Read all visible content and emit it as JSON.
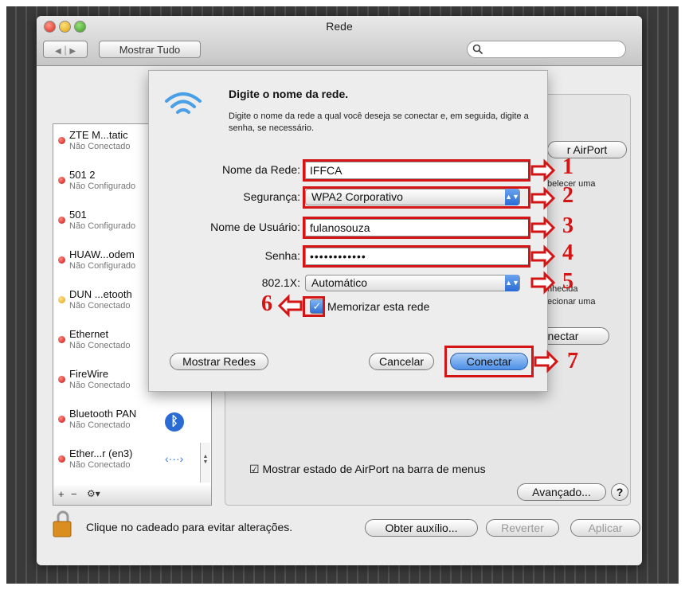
{
  "window": {
    "title": "Rede",
    "show_all_label": "Mostrar Tudo"
  },
  "sidebar": {
    "items": [
      {
        "name": "ZTE M...tatic",
        "status": "Não Conectado"
      },
      {
        "name": "501 2",
        "status": "Não Configurado"
      },
      {
        "name": "501",
        "status": "Não Configurado"
      },
      {
        "name": "HUAW...odem",
        "status": "Não Configurado"
      },
      {
        "name": "DUN ...etooth",
        "status": "Não Conectado"
      },
      {
        "name": "Ethernet",
        "status": "Não Conectado"
      },
      {
        "name": "FireWire",
        "status": "Não Conectado"
      },
      {
        "name": "Bluetooth PAN",
        "status": "Não Conectado"
      },
      {
        "name": "Ether...r (en3)",
        "status": "Não Conectado"
      }
    ]
  },
  "panel": {
    "airport_button": "r AirPort",
    "connect_button": "nectar",
    "show_status_label": "Mostrar estado de AirPort na barra de menus",
    "advanced_button": "Avançado...",
    "help": "?",
    "behind_text_1": "belecer uma",
    "behind_text_2": "ecionar uma",
    "behind_text_3": "nhecida"
  },
  "footer": {
    "lock_text": "Clique no cadeado para evitar alterações.",
    "help_button": "Obter auxílio...",
    "revert_button": "Reverter",
    "apply_button": "Aplicar"
  },
  "sheet": {
    "heading": "Digite o nome da rede.",
    "description": "Digite o nome da rede a qual você deseja se conectar e, em seguida, digite a senha, se necessário.",
    "network_label": "Nome da Rede:",
    "network_value": "IFFCA",
    "security_label": "Segurança:",
    "security_value": "WPA2 Corporativo",
    "username_label": "Nome de Usuário:",
    "username_value": "fulanosouza",
    "password_label": "Senha:",
    "password_value": "••••••••••••",
    "dot1x_label": "802.1X:",
    "dot1x_value": "Automático",
    "remember_label": "Memorizar esta rede",
    "show_networks_button": "Mostrar Redes",
    "cancel_button": "Cancelar",
    "connect_button": "Conectar"
  },
  "annotations": {
    "n1": "1",
    "n2": "2",
    "n3": "3",
    "n4": "4",
    "n5": "5",
    "n6": "6",
    "n7": "7"
  },
  "colors": {
    "annotation_red": "#d41515",
    "default_button_blue": "#2a6ad4"
  }
}
